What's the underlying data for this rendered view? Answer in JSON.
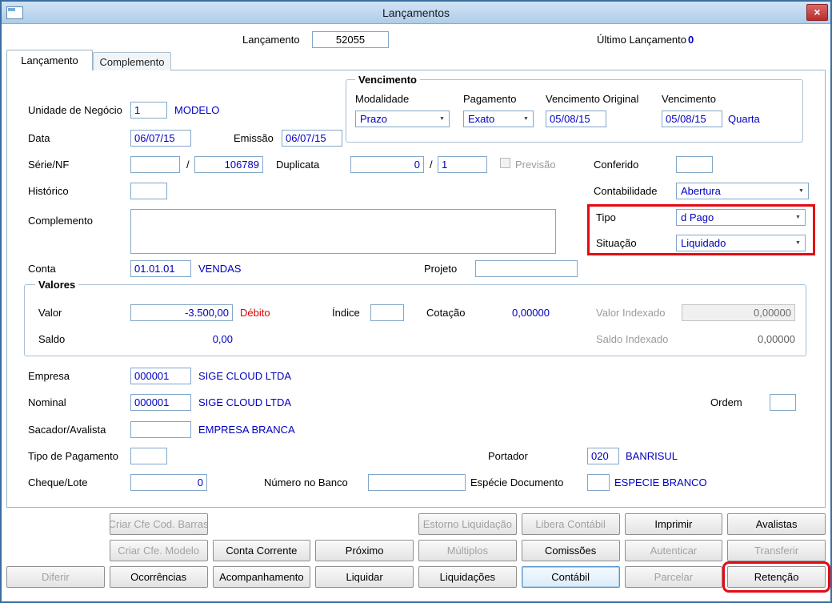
{
  "window": {
    "title": "Lançamentos",
    "close": "×"
  },
  "header": {
    "lancamento_label": "Lançamento",
    "lancamento_value": "52055",
    "ultimo_lancamento_label": "Último Lançamento",
    "ultimo_lancamento_value": "0"
  },
  "tabs": [
    {
      "label": "Lançamento"
    },
    {
      "label": "Complemento"
    }
  ],
  "icons": {
    "combo_arrow": "▼"
  },
  "colors": {
    "value_blue": "#0000bf",
    "debit_red": "#e00000",
    "highlight_red": "#e30b13",
    "titlebar_blue": "#aecde9"
  },
  "form": {
    "unidade": {
      "label": "Unidade de Negócio",
      "value": "1",
      "desc": "MODELO"
    },
    "vencimento_group": {
      "title": "Vencimento",
      "modalidade": {
        "label": "Modalidade",
        "value": "Prazo"
      },
      "pagamento": {
        "label": "Pagamento",
        "value": "Exato"
      },
      "vencimento_original": {
        "label": "Vencimento Original",
        "value": "05/08/15"
      },
      "vencimento": {
        "label": "Vencimento",
        "value": "05/08/15",
        "weekday": "Quarta"
      }
    },
    "data": {
      "label": "Data",
      "value": "06/07/15"
    },
    "emissao": {
      "label": "Emissão",
      "value": "06/07/15"
    },
    "serie_nf": {
      "label": "Série/NF",
      "serie_value": "",
      "separator": "/",
      "nf_value": "106789"
    },
    "duplicata": {
      "label": "Duplicata",
      "value": "0",
      "separator": "/",
      "value2": "1"
    },
    "previsao": {
      "label": "Previsão"
    },
    "conferido": {
      "label": "Conferido",
      "value": ""
    },
    "historico": {
      "label": "Histórico",
      "value": ""
    },
    "contabilidade": {
      "label": "Contabilidade",
      "value": "Abertura"
    },
    "complemento": {
      "label": "Complemento",
      "value": ""
    },
    "tipo": {
      "label": "Tipo",
      "value": "d Pago"
    },
    "situacao": {
      "label": "Situação",
      "value": "Liquidado"
    },
    "conta": {
      "label": "Conta",
      "value": "01.01.01",
      "desc": "VENDAS"
    },
    "projeto": {
      "label": "Projeto",
      "value": ""
    },
    "valores_group": {
      "title": "Valores",
      "valor": {
        "label": "Valor",
        "value": "-3.500,00",
        "tag": "Débito"
      },
      "indice": {
        "label": "Índice",
        "value": ""
      },
      "cotacao": {
        "label": "Cotação",
        "value": "0,00000"
      },
      "valor_indexado": {
        "label": "Valor Indexado",
        "value": "0,00000"
      },
      "saldo": {
        "label": "Saldo",
        "value": "0,00"
      },
      "saldo_indexado": {
        "label": "Saldo Indexado",
        "value": "0,00000"
      }
    },
    "empresa": {
      "label": "Empresa",
      "value": "000001",
      "desc": "SIGE CLOUD LTDA"
    },
    "nominal": {
      "label": "Nominal",
      "value": "000001",
      "desc": "SIGE CLOUD LTDA"
    },
    "ordem": {
      "label": "Ordem",
      "value": ""
    },
    "sacador": {
      "label": "Sacador/Avalista",
      "value": "",
      "desc": "EMPRESA BRANCA"
    },
    "tipo_pagamento": {
      "label": "Tipo de Pagamento",
      "value": ""
    },
    "portador": {
      "label": "Portador",
      "value": "020",
      "desc": "BANRISUL"
    },
    "cheque_lote": {
      "label": "Cheque/Lote",
      "value": "0"
    },
    "numero_banco": {
      "label": "Número no Banco",
      "value": ""
    },
    "especie": {
      "label": "Espécie Documento",
      "value": "",
      "desc": "ESPECIE BRANCO"
    }
  },
  "buttons": {
    "rows": [
      [
        {
          "label": "",
          "state": "empty"
        },
        {
          "label": "Criar Cfe Cod. Barras",
          "state": "disabled"
        },
        {
          "label": "",
          "state": "empty"
        },
        {
          "label": "",
          "state": "empty"
        },
        {
          "label": "Estorno Liquidação",
          "state": "disabled"
        },
        {
          "label": "Libera Contábil",
          "state": "disabled"
        },
        {
          "label": "Imprimir",
          "state": "enabled"
        },
        {
          "label": "Avalistas",
          "state": "enabled"
        }
      ],
      [
        {
          "label": "",
          "state": "empty"
        },
        {
          "label": "Criar Cfe. Modelo",
          "state": "disabled"
        },
        {
          "label": "Conta Corrente",
          "state": "enabled"
        },
        {
          "label": "Próximo",
          "state": "enabled"
        },
        {
          "label": "Múltiplos",
          "state": "disabled"
        },
        {
          "label": "Comissões",
          "state": "enabled"
        },
        {
          "label": "Autenticar",
          "state": "disabled"
        },
        {
          "label": "Transferir",
          "state": "disabled"
        }
      ],
      [
        {
          "label": "Diferir",
          "state": "disabled"
        },
        {
          "label": "Ocorrências",
          "state": "enabled"
        },
        {
          "label": "Acompanhamento",
          "state": "enabled"
        },
        {
          "label": "Liquidar",
          "state": "enabled"
        },
        {
          "label": "Liquidações",
          "state": "enabled"
        },
        {
          "label": "Contábil",
          "state": "enabled"
        },
        {
          "label": "Parcelar",
          "state": "disabled"
        },
        {
          "label": "Retenção",
          "state": "enabled"
        }
      ]
    ]
  }
}
